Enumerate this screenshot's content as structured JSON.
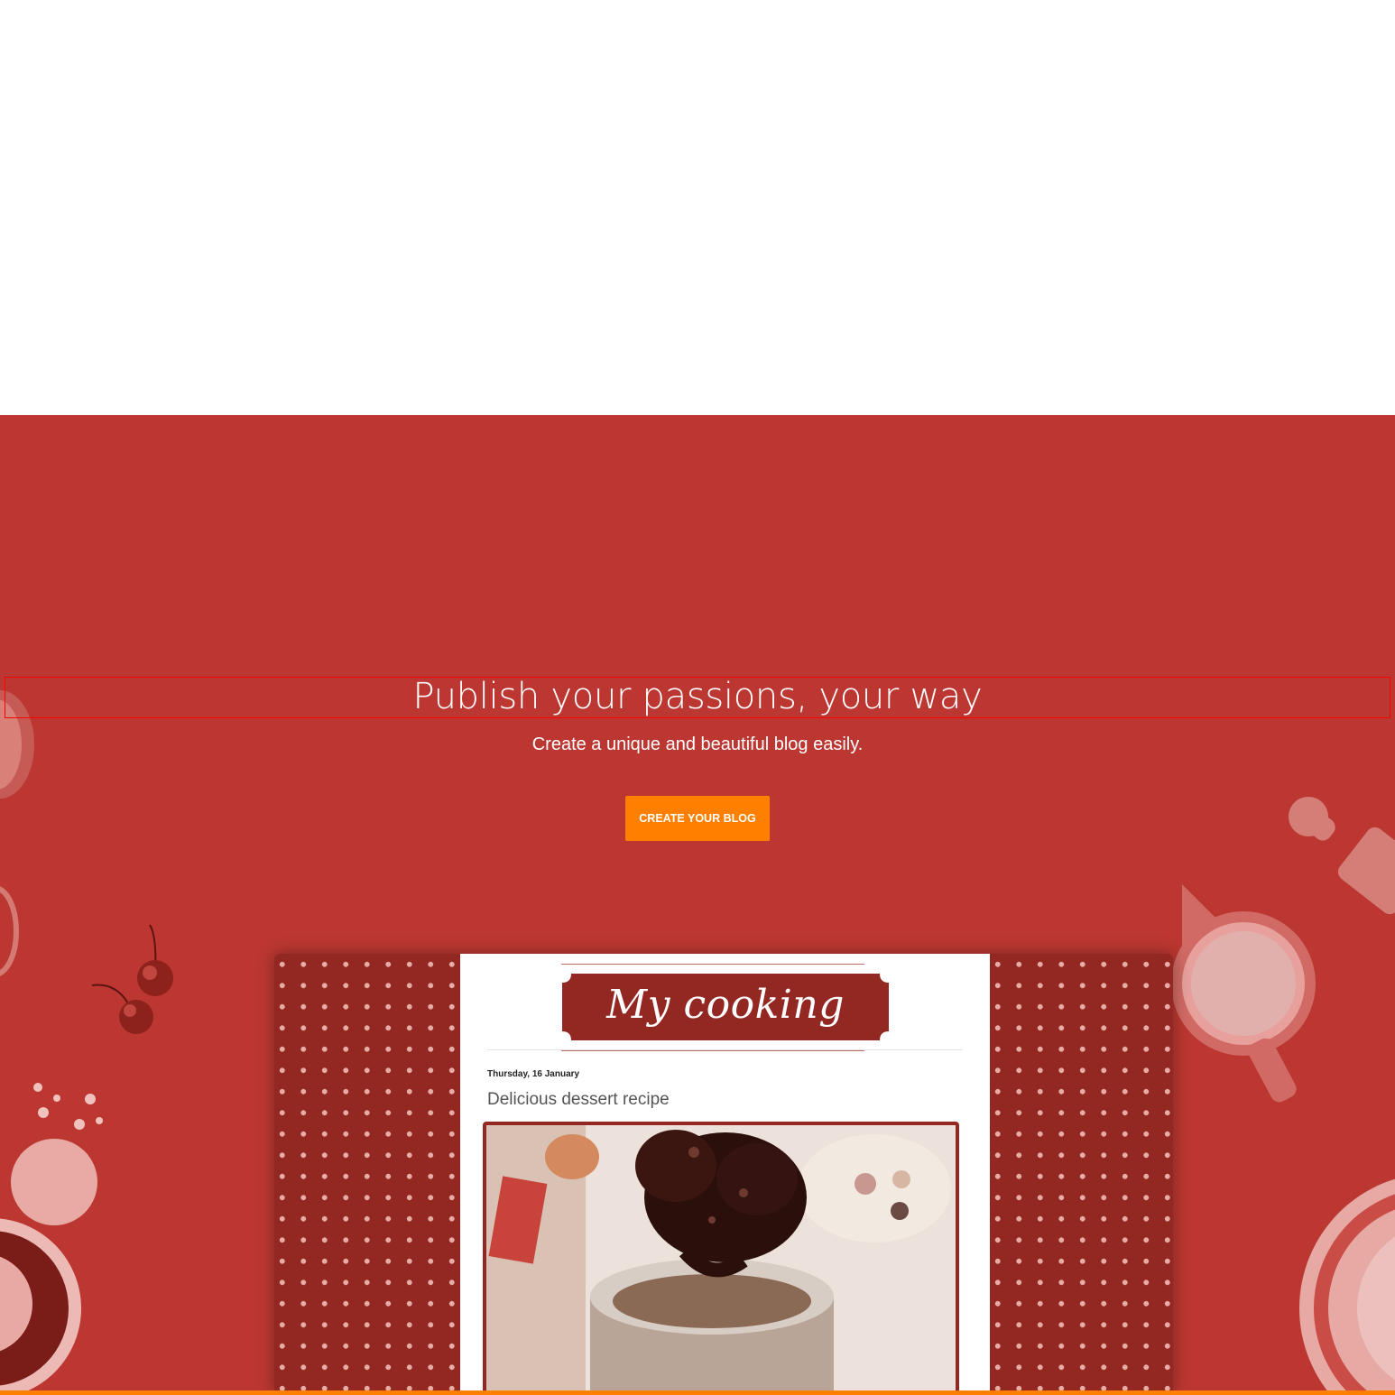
{
  "hero": {
    "headline": "Publish your passions, your way",
    "subheadline": "Create a unique and beautiful blog easily.",
    "cta_label": "CREATE YOUR BLOG"
  },
  "preview": {
    "blog_title": "My cooking blog",
    "post_date": "Thursday, 16 January",
    "post_title": "Delicious dessert recipe"
  },
  "colors": {
    "hero_background": "#bc3731",
    "cta_background": "#ff8000",
    "preview_pattern": "#932722",
    "bottom_bar": "#ff8000"
  },
  "icons": [
    "cherries-icon",
    "pitcher-icon",
    "rolling-pin-icon",
    "bowl-icon",
    "spoon-icon",
    "sprinkles-icon"
  ]
}
